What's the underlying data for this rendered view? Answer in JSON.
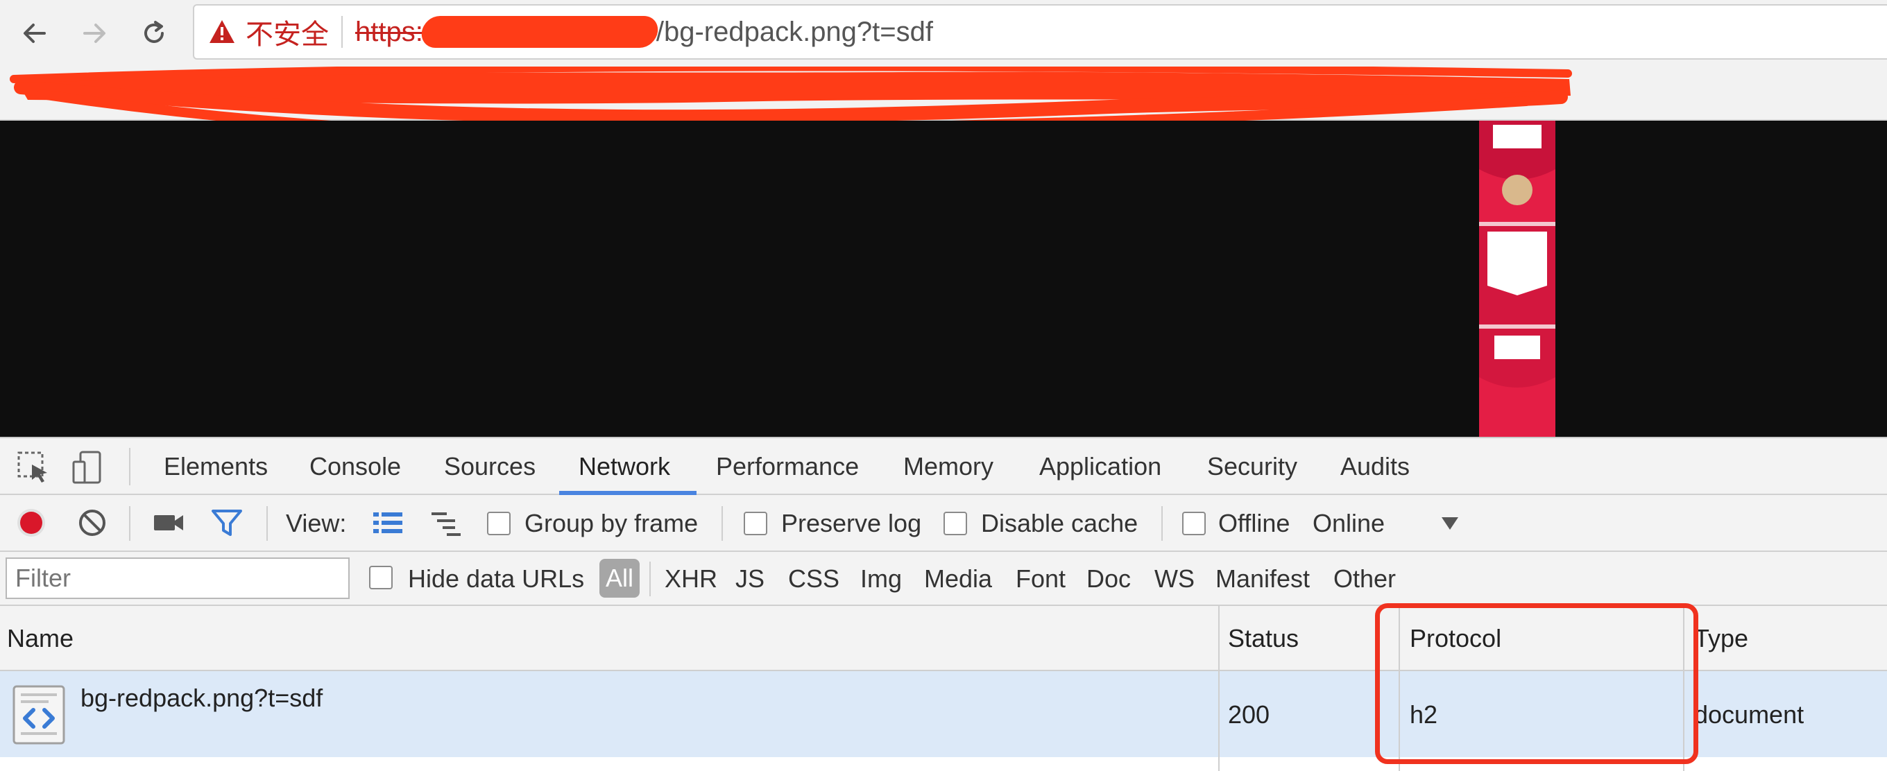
{
  "browser": {
    "insecure_label": "不安全",
    "url_scheme": "https:",
    "url_path": "/bg-redpack.png?t=sdf"
  },
  "devtools": {
    "tabs": [
      "Elements",
      "Console",
      "Sources",
      "Network",
      "Performance",
      "Memory",
      "Application",
      "Security",
      "Audits"
    ],
    "active_tab": "Network",
    "network_toolbar": {
      "view_label": "View:",
      "group_by_frame": "Group by frame",
      "preserve_log": "Preserve log",
      "disable_cache": "Disable cache",
      "offline": "Offline",
      "throttling": "Online"
    },
    "filter_bar": {
      "placeholder": "Filter",
      "hide_data_urls": "Hide data URLs",
      "types": [
        "All",
        "XHR",
        "JS",
        "CSS",
        "Img",
        "Media",
        "Font",
        "Doc",
        "WS",
        "Manifest",
        "Other"
      ],
      "active_type": "All"
    },
    "table": {
      "headers": {
        "name": "Name",
        "status": "Status",
        "protocol": "Protocol",
        "type": "Type"
      },
      "rows": [
        {
          "name": "bg-redpack.png?t=sdf",
          "status": "200",
          "protocol": "h2",
          "type": "document"
        }
      ]
    }
  },
  "colors": {
    "annotation_red": "#f0321f",
    "redaction_orange": "#ff3c17",
    "selected_row": "#dce9f8",
    "active_tab_underline": "#4a84e0"
  }
}
